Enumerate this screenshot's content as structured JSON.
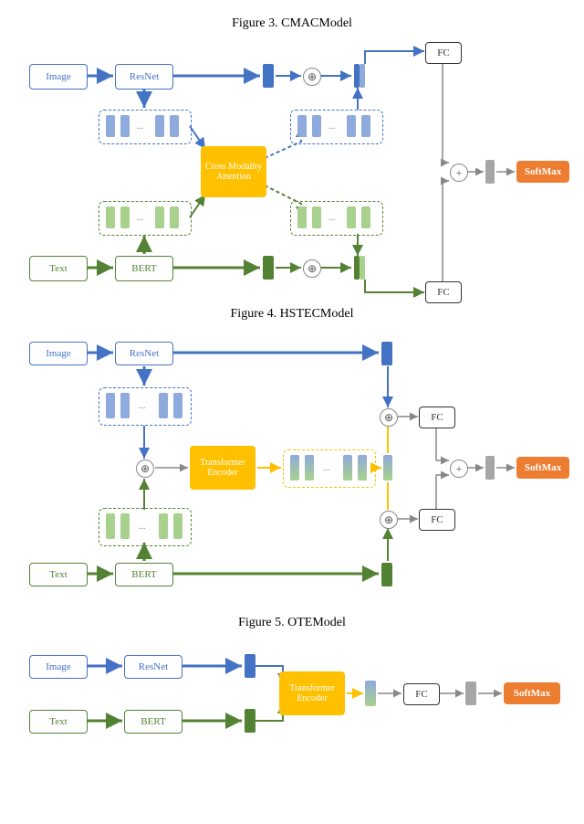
{
  "figures": {
    "fig3": "Figure 3. CMACModel",
    "fig4": "Figure 4. HSTECModel",
    "fig5": "Figure 5. OTEModel"
  },
  "labels": {
    "image": "Image",
    "text": "Text",
    "resnet": "ResNet",
    "bert": "BERT",
    "fc": "FC",
    "softmax": "SoftMax",
    "cma": "Cross Modality\nAttention",
    "te": "Transformer\nEncoder",
    "dots": "...",
    "plus": "+",
    "oplus": "⊕"
  },
  "colors": {
    "blue": "#4472C4",
    "blue_light": "#8FAADC",
    "green": "#548235",
    "green_light": "#A9D18E",
    "gray": "#A6A6A6",
    "orange": "#ED7D31",
    "yellow": "#FFC000"
  },
  "chart_data": {
    "type": "diagram",
    "figures": [
      {
        "name": "CMACModel",
        "inputs": [
          "Image",
          "Text"
        ],
        "encoders": {
          "Image": "ResNet",
          "Text": "BERT"
        },
        "fusion": "Cross Modality Attention",
        "postfusion": [
          "element-wise add (image path)",
          "element-wise add (text path)"
        ],
        "heads": [
          "FC (image)",
          "FC (text)"
        ],
        "combine": "sum then SoftMax"
      },
      {
        "name": "HSTECModel",
        "inputs": [
          "Image",
          "Text"
        ],
        "encoders": {
          "Image": "ResNet",
          "Text": "BERT"
        },
        "fusion": "Transformer Encoder over concatenated token features",
        "postfusion": [
          "concat with image global",
          "concat with text global"
        ],
        "heads": [
          "FC (image)",
          "FC (text)"
        ],
        "combine": "sum then SoftMax"
      },
      {
        "name": "OTEModel",
        "inputs": [
          "Image",
          "Text"
        ],
        "encoders": {
          "Image": "ResNet",
          "Text": "BERT"
        },
        "fusion": "Transformer Encoder",
        "heads": [
          "FC"
        ],
        "combine": "SoftMax"
      }
    ]
  }
}
